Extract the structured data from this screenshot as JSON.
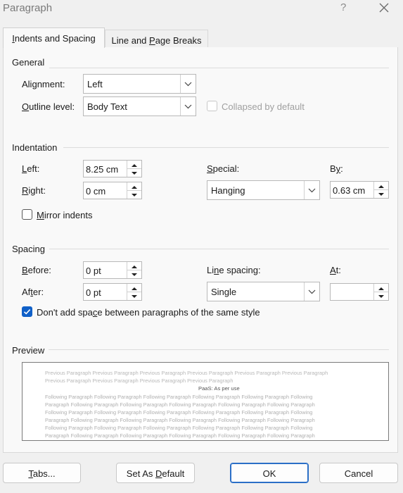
{
  "window": {
    "title": "Paragraph",
    "help": "?"
  },
  "tabs": [
    {
      "pre": "",
      "key": "I",
      "post": "ndents and Spacing",
      "active": true
    },
    {
      "pre": "Line and ",
      "key": "P",
      "post": "age Breaks",
      "active": false
    }
  ],
  "general": {
    "title": "General",
    "alignment": {
      "pre": "Ali",
      "key": "g",
      "post": "nment:",
      "value": "Left"
    },
    "outline": {
      "pre": "",
      "key": "O",
      "post": "utline level:",
      "value": "Body Text"
    },
    "collapsed": {
      "label": "Collapsed by default",
      "checked": false,
      "disabled": true
    }
  },
  "indentation": {
    "title": "Indentation",
    "left": {
      "pre": "",
      "key": "L",
      "post": "eft:",
      "value": "8.25 cm"
    },
    "right": {
      "pre": "",
      "key": "R",
      "post": "ight:",
      "value": "0 cm"
    },
    "special": {
      "pre": "",
      "key": "S",
      "post": "pecial:",
      "value": "Hanging"
    },
    "by": {
      "pre": "B",
      "key": "y",
      "post": ":",
      "value": "0.63 cm"
    },
    "mirror": {
      "pre": "",
      "key": "M",
      "post": "irror indents",
      "checked": false
    }
  },
  "spacing": {
    "title": "Spacing",
    "before": {
      "pre": "",
      "key": "B",
      "post": "efore:",
      "value": "0 pt"
    },
    "after": {
      "pre": "Af",
      "key": "t",
      "post": "er:",
      "value": "0 pt"
    },
    "line_spacing": {
      "pre": "Li",
      "key": "n",
      "post": "e spacing:",
      "value": "Single"
    },
    "at": {
      "pre": "",
      "key": "A",
      "post": "t:",
      "value": ""
    },
    "dont_add": {
      "pre": "Don't add spa",
      "key": "c",
      "post": "e between paragraphs of the same style",
      "checked": true
    }
  },
  "preview": {
    "title": "Preview",
    "previous_lines": [
      "Previous Paragraph Previous Paragraph Previous Paragraph Previous Paragraph Previous Paragraph Previous Paragraph",
      "Previous Paragraph Previous Paragraph Previous Paragraph Previous Paragraph"
    ],
    "current_line": "PaaS: As per use",
    "following_lines": [
      "Following Paragraph Following Paragraph Following Paragraph Following Paragraph Following Paragraph Following",
      "Paragraph Following Paragraph Following Paragraph Following Paragraph Following Paragraph Following Paragraph",
      "Following Paragraph Following Paragraph Following Paragraph Following Paragraph Following Paragraph Following",
      "Paragraph Following Paragraph Following Paragraph Following Paragraph Following Paragraph Following Paragraph",
      "Following Paragraph Following Paragraph Following Paragraph Following Paragraph Following Paragraph Following",
      "Paragraph Following Paragraph Following Paragraph Following Paragraph Following Paragraph Following Paragraph"
    ]
  },
  "buttons": {
    "tabs": {
      "pre": "",
      "key": "T",
      "post": "abs..."
    },
    "set_default": {
      "pre": "Set As ",
      "key": "D",
      "post": "efault"
    },
    "ok": {
      "label": "OK"
    },
    "cancel": {
      "label": "Cancel"
    }
  },
  "colors": {
    "accent": "#1060c8",
    "ok_border": "#2b6fc7",
    "panel": "#f9f9f9",
    "chrome": "#f0f0f0"
  }
}
